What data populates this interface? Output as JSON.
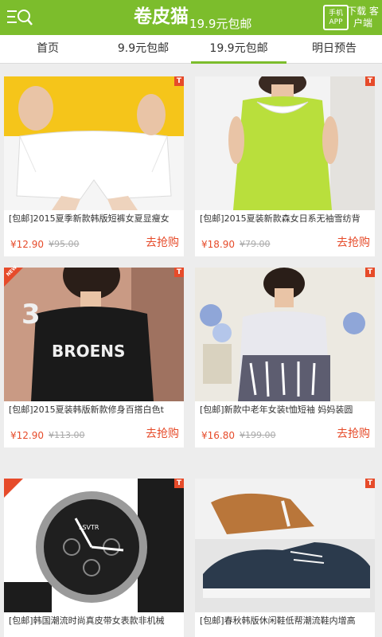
{
  "header": {
    "brand": "卷皮猫",
    "subtitle": "19.9元包邮",
    "app_icon_text": "手机APP",
    "download_label": "下载 客户端"
  },
  "tabs": [
    {
      "label": "首页",
      "active": false
    },
    {
      "label": "9.9元包邮",
      "active": false
    },
    {
      "label": "19.9元包邮",
      "active": true
    },
    {
      "label": "明日预告",
      "active": false
    }
  ],
  "products": [
    {
      "title": "[包邮]2015夏季新款韩版短裤女夏显瘦女",
      "price": "¥12.90",
      "original_price": "¥95.00",
      "action": "去抢购",
      "badge_t": "T"
    },
    {
      "title": "[包邮]2015夏装新款森女日系无袖雪纺背",
      "price": "¥18.90",
      "original_price": "¥79.00",
      "action": "去抢购",
      "badge_t": "T"
    },
    {
      "title": "[包邮]2015夏装韩版新款修身百搭白色t",
      "price": "¥12.90",
      "original_price": "¥113.00",
      "action": "去抢购",
      "badge_t": "T",
      "badge_new": "NEW"
    },
    {
      "title": "[包邮]新款中老年女装t恤短袖 妈妈装圆",
      "price": "¥16.80",
      "original_price": "¥199.00",
      "action": "去抢购",
      "badge_t": "T"
    },
    {
      "title": "[包邮]韩国潮流时尚真皮带女表款非机械",
      "price": "",
      "original_price": "",
      "action": "",
      "badge_t": "T"
    },
    {
      "title": "[包邮]春秋韩版休闲鞋低帮潮流鞋内增高",
      "price": "",
      "original_price": "",
      "action": "",
      "badge_t": "T"
    }
  ],
  "image_text": {
    "shirt_print": "BROENS",
    "watch_brand": "LSVTR"
  },
  "colors": {
    "brand_green": "#7cbd2c",
    "accent_red": "#e64b2a"
  }
}
